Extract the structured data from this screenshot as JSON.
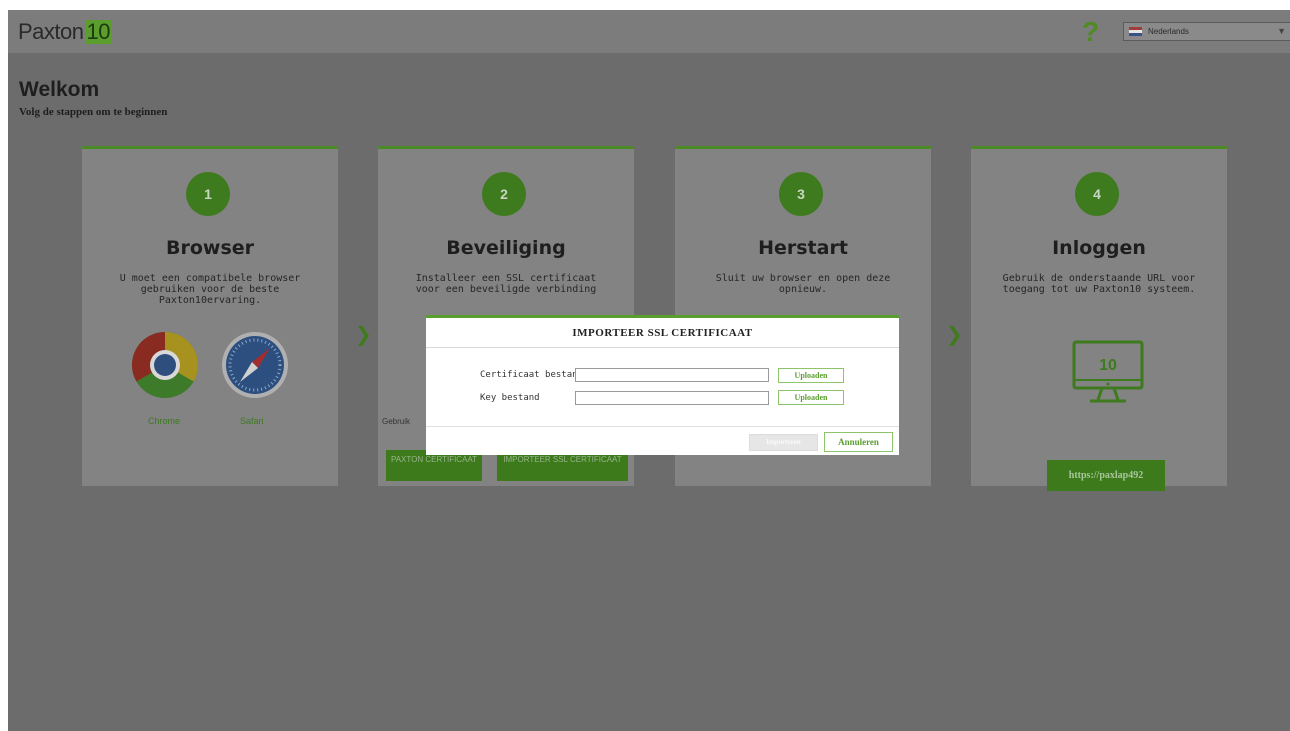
{
  "header": {
    "logo_text": "Paxton",
    "logo_number": "10",
    "help_symbol": "?",
    "language": {
      "selected": "Nederlands",
      "flag_icon": "netherlands-flag-icon"
    }
  },
  "page": {
    "title": "Welkom",
    "subtitle": "Volg de stappen om te beginnen"
  },
  "steps": [
    {
      "number": "1",
      "title": "Browser",
      "description": "U moet een compatibele browser gebruiken voor de beste Paxton10ervaring.",
      "browsers": [
        "Chrome",
        "Safari"
      ]
    },
    {
      "number": "2",
      "title": "Beveiliging",
      "description": "Installeer een SSL certificaat voor een beveiligde verbinding",
      "note_fragment": "Gebruik",
      "buttons": [
        "PAXTON CERTIFICAAT",
        "IMPORTEER SSL CERTIFICAAT"
      ]
    },
    {
      "number": "3",
      "title": "Herstart",
      "description": "Sluit uw browser en open deze opnieuw."
    },
    {
      "number": "4",
      "title": "Inloggen",
      "description": "Gebruik de onderstaande URL voor toegang tot uw Paxton10 systeem.",
      "monitor_number": "10",
      "url": "https://paxlap492"
    }
  ],
  "modal": {
    "title": "IMPORTEER SSL CERTIFICAAT",
    "fields": [
      {
        "label": "Certificaat bestand",
        "value": "",
        "upload_label": "Uploaden"
      },
      {
        "label": "Key bestand",
        "value": "",
        "upload_label": "Uploaden"
      }
    ],
    "import_label": "Importeren",
    "cancel_label": "Annuleren"
  },
  "colors": {
    "accent": "#5a9e2e",
    "overlay_bg": "#6c6c6c",
    "card_bg": "#838383"
  }
}
